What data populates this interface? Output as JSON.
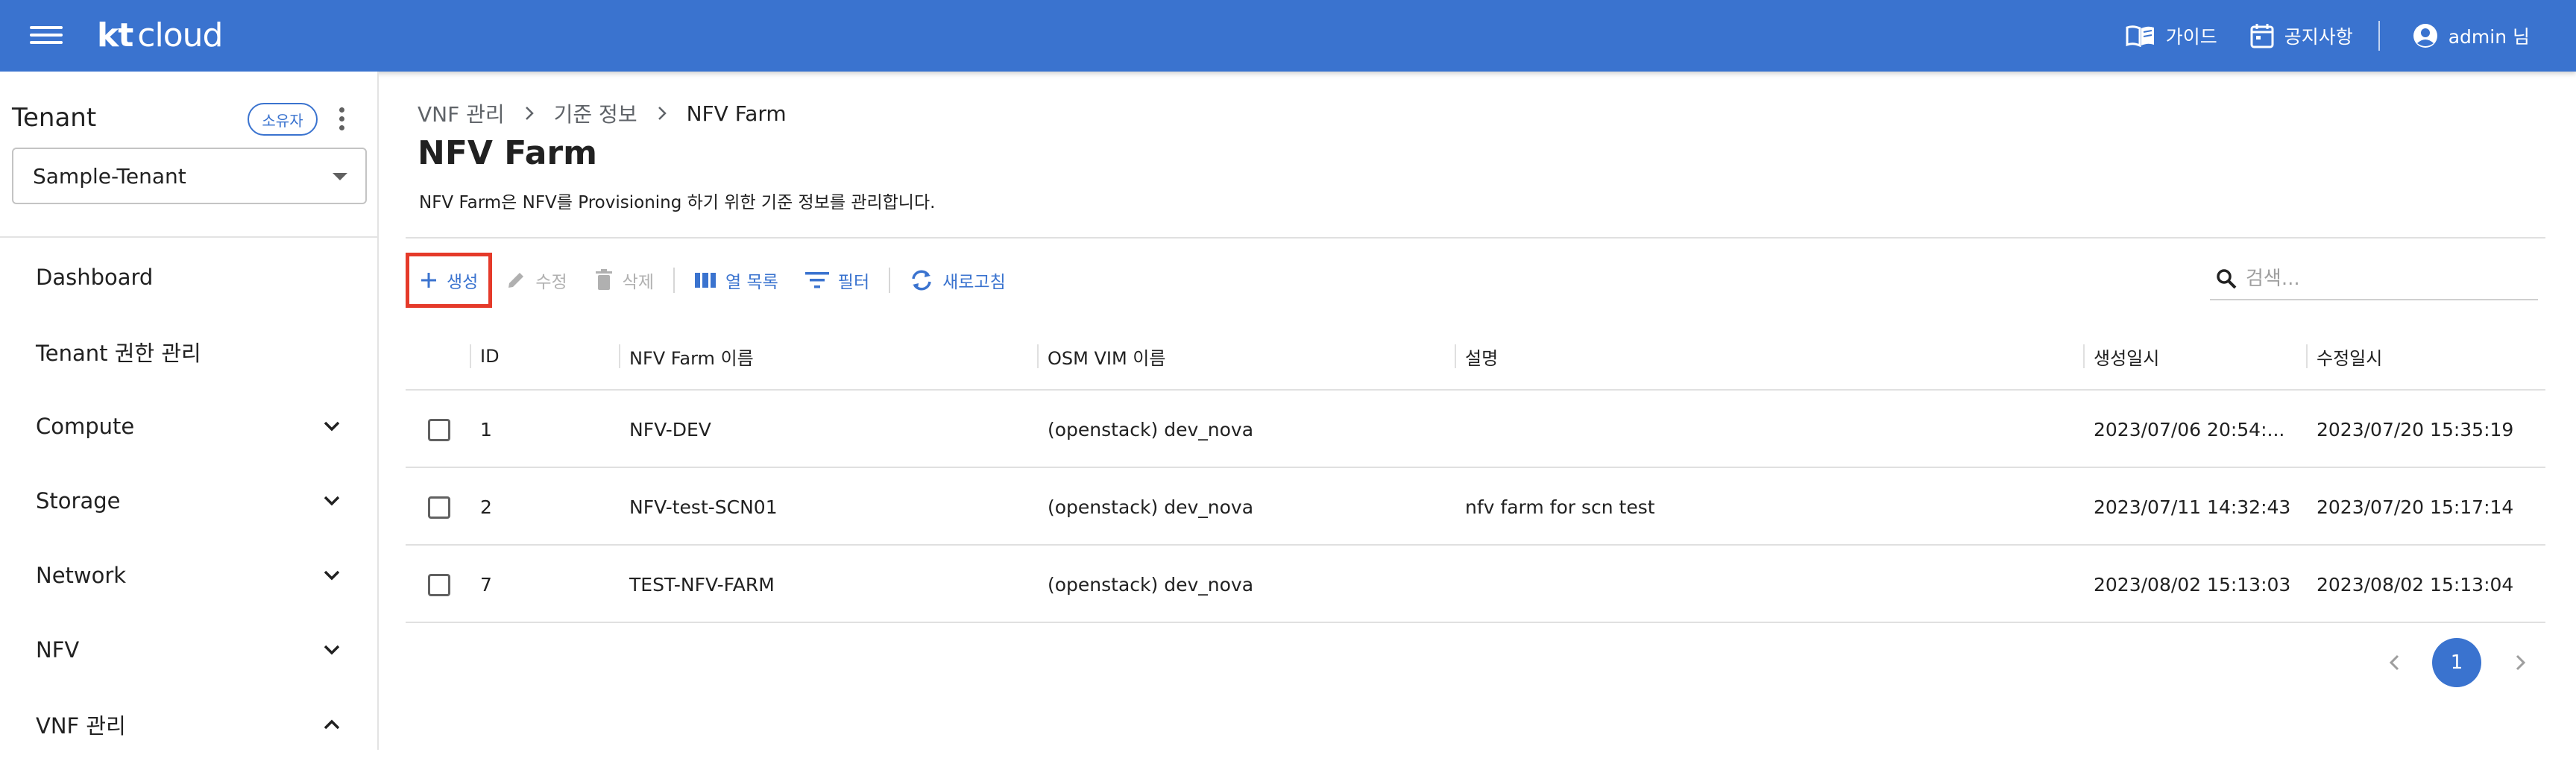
{
  "header": {
    "logo_kt": "kt",
    "logo_cloud": "cloud",
    "guide_label": "가이드",
    "notice_label": "공지사항",
    "user_label": "admin 님",
    "icons": [
      "menu-icon",
      "book-icon",
      "calendar-icon",
      "account-circle-icon"
    ]
  },
  "sidebar": {
    "tenant_title": "Tenant",
    "owner_badge": "소유자",
    "tenant_selected": "Sample-Tenant",
    "items": [
      {
        "label": "Dashboard",
        "chevron": "none"
      },
      {
        "label": "Tenant 권한 관리",
        "chevron": "none"
      },
      {
        "label": "Compute",
        "chevron": "down"
      },
      {
        "label": "Storage",
        "chevron": "down"
      },
      {
        "label": "Network",
        "chevron": "down"
      },
      {
        "label": "NFV",
        "chevron": "down"
      },
      {
        "label": "VNF 관리",
        "chevron": "up"
      }
    ]
  },
  "breadcrumb": [
    "VNF 관리",
    "기준 정보",
    "NFV Farm"
  ],
  "page": {
    "title": "NFV Farm",
    "description": "NFV Farm은 NFV를 Provisioning 하기 위한 기준 정보를 관리합니다."
  },
  "toolbar": {
    "create": "생성",
    "edit": "수정",
    "delete": "삭제",
    "columns": "열 목록",
    "filter": "필터",
    "refresh": "새로고침",
    "search_placeholder": "검색..."
  },
  "table": {
    "columns": [
      "ID",
      "NFV Farm 이름",
      "OSM VIM 이름",
      "설명",
      "생성일시",
      "수정일시"
    ],
    "rows": [
      {
        "id": "1",
        "name": "NFV-DEV",
        "vim": "(openstack) dev_nova",
        "desc": "",
        "created": "2023/07/06 20:54:...",
        "updated": "2023/07/20 15:35:19"
      },
      {
        "id": "2",
        "name": "NFV-test-SCN01",
        "vim": "(openstack) dev_nova",
        "desc": "nfv farm for scn test",
        "created": "2023/07/11 14:32:43",
        "updated": "2023/07/20 15:17:14"
      },
      {
        "id": "7",
        "name": "TEST-NFV-FARM",
        "vim": "(openstack) dev_nova",
        "desc": "",
        "created": "2023/08/02 15:13:03",
        "updated": "2023/08/02 15:13:04"
      }
    ]
  },
  "pagination": {
    "current": "1"
  },
  "colors": {
    "primary": "#3a73cf",
    "highlight": "#e53a2a"
  }
}
